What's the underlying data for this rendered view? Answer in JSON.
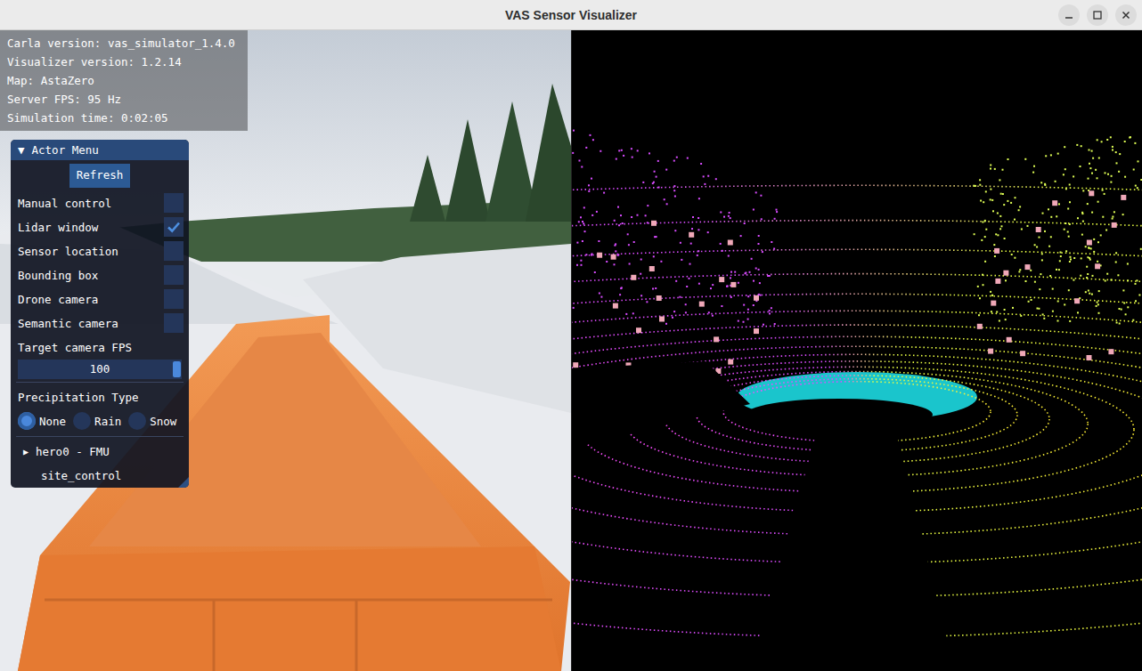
{
  "window": {
    "title": "VAS Sensor Visualizer"
  },
  "info": [
    "Carla version: vas_simulator_1.4.0",
    "Visualizer version: 1.2.14",
    "Map: AstaZero",
    "Server FPS:  95 Hz",
    "Simulation time: 0:02:05"
  ],
  "actor_menu": {
    "arrow": "▼",
    "title": "Actor Menu",
    "refresh": "Refresh",
    "toggles": [
      {
        "label": "Manual control",
        "checked": false
      },
      {
        "label": "Lidar window",
        "checked": true
      },
      {
        "label": "Sensor location",
        "checked": false
      },
      {
        "label": "Bounding box",
        "checked": false
      },
      {
        "label": "Drone camera",
        "checked": false
      },
      {
        "label": "Semantic camera",
        "checked": false
      }
    ],
    "fps": {
      "label": "Target camera FPS",
      "value": "100",
      "level": 1.0
    },
    "precipitation": {
      "label": "Precipitation Type",
      "options": [
        {
          "label": "None",
          "selected": true
        },
        {
          "label": "Rain",
          "selected": false
        },
        {
          "label": "Snow",
          "selected": false
        }
      ]
    },
    "actors": [
      {
        "kind": "node",
        "arrow": "▶",
        "label": "hero0 - FMU",
        "expanded": false
      },
      {
        "kind": "leaf",
        "label": "site_control"
      }
    ]
  }
}
